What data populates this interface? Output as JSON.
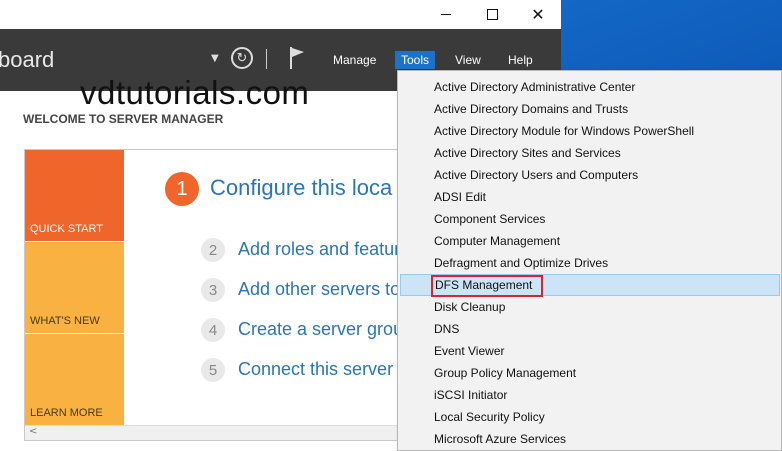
{
  "window": {
    "header_title": "board",
    "controls": {
      "minimize": "minimize",
      "maximize": "maximize",
      "close": "close"
    }
  },
  "header": {
    "menu": {
      "manage": "Manage",
      "tools": "Tools",
      "view": "View",
      "help": "Help"
    },
    "refresh_glyph": "↻",
    "dropdown_glyph": "▼"
  },
  "watermark": "vdtutorials.com",
  "welcome": {
    "title": "WELCOME TO SERVER MANAGER",
    "tiles": {
      "quick_start": "QUICK START",
      "whats_new": "WHAT'S NEW",
      "learn_more": "LEARN MORE"
    },
    "step1": {
      "number": "1",
      "text": "Configure this loca"
    },
    "steps": [
      {
        "number": "2",
        "text": "Add roles and featur"
      },
      {
        "number": "3",
        "text": "Add other servers to"
      },
      {
        "number": "4",
        "text": "Create a server grou"
      },
      {
        "number": "5",
        "text": "Connect this server t"
      }
    ]
  },
  "tools_menu": {
    "items": [
      "Active Directory Administrative Center",
      "Active Directory Domains and Trusts",
      "Active Directory Module for Windows PowerShell",
      "Active Directory Sites and Services",
      "Active Directory Users and Computers",
      "ADSI Edit",
      "Component Services",
      "Computer Management",
      "Defragment and Optimize Drives",
      "DFS Management",
      "Disk Cleanup",
      "DNS",
      "Event Viewer",
      "Group Policy Management",
      "iSCSI Initiator",
      "Local Security Policy",
      "Microsoft Azure Services"
    ],
    "highlighted_index": 9,
    "highlight_color": "#cce4f7",
    "annotation_color": "#d9262c"
  }
}
